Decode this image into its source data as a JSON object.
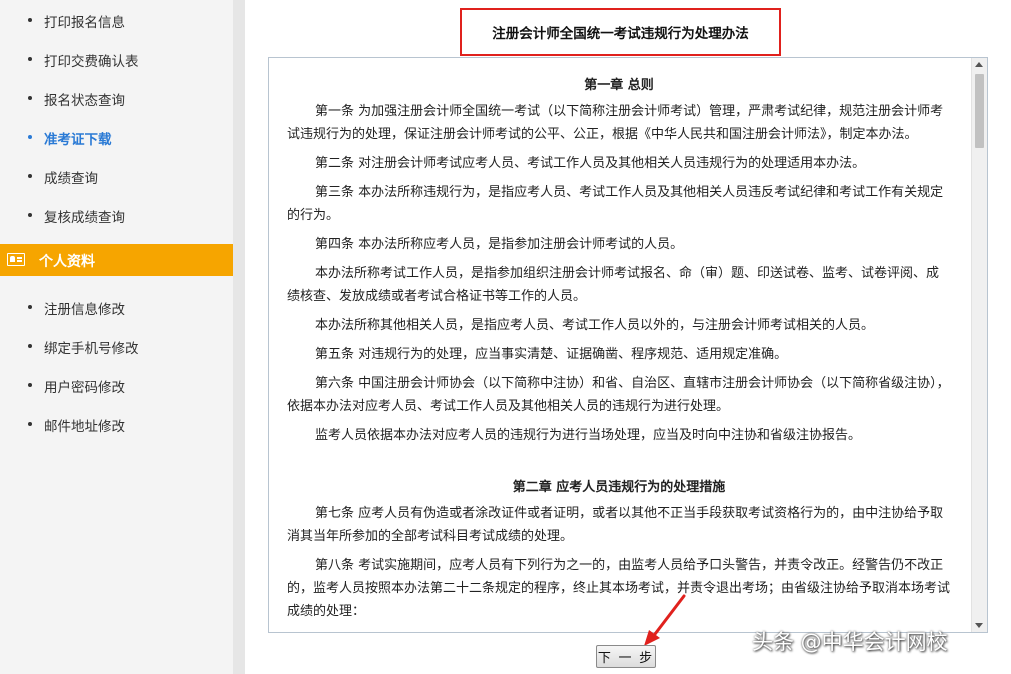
{
  "sidebar": {
    "items_top": [
      {
        "label": "打印报名信息"
      },
      {
        "label": "打印交费确认表"
      },
      {
        "label": "报名状态查询"
      },
      {
        "label": "准考证下载"
      },
      {
        "label": "成绩查询"
      },
      {
        "label": "复核成绩查询"
      }
    ],
    "section_label": "个人资料",
    "section_icon": "id-card-icon",
    "items_bottom": [
      {
        "label": "注册信息修改"
      },
      {
        "label": "绑定手机号修改"
      },
      {
        "label": "用户密码修改"
      },
      {
        "label": "邮件地址修改"
      }
    ],
    "active_item": "准考证下载",
    "accent_color": "#f6a500",
    "active_color": "#2a7ad5"
  },
  "document": {
    "title": "注册会计师全国统一考试违规行为处理办法",
    "chapter1": "第一章 总则",
    "paragraphs1": [
      "第一条 为加强注册会计师全国统一考试（以下简称注册会计师考试）管理，严肃考试纪律，规范注册会计师考试违规行为的处理，保证注册会计师考试的公平、公正，根据《中华人民共和国注册会计师法》，制定本办法。",
      "第二条 对注册会计师考试应考人员、考试工作人员及其他相关人员违规行为的处理适用本办法。",
      "第三条 本办法所称违规行为，是指应考人员、考试工作人员及其他相关人员违反考试纪律和考试工作有关规定的行为。",
      "第四条 本办法所称应考人员，是指参加注册会计师考试的人员。",
      "本办法所称考试工作人员，是指参加组织注册会计师考试报名、命（审）题、印送试卷、监考、试卷评阅、成绩核查、发放成绩或者考试合格证书等工作的人员。",
      "本办法所称其他相关人员，是指应考人员、考试工作人员以外的，与注册会计师考试相关的人员。",
      "第五条 对违规行为的处理，应当事实清楚、证据确凿、程序规范、适用规定准确。",
      "第六条 中国注册会计师协会（以下简称中注协）和省、自治区、直辖市注册会计师协会（以下简称省级注协），依据本办法对应考人员、考试工作人员及其他相关人员的违规行为进行处理。",
      "监考人员依据本办法对应考人员的违规行为进行当场处理，应当及时向中注协和省级注协报告。"
    ],
    "chapter2": "第二章 应考人员违规行为的处理措施",
    "paragraphs2": [
      "第七条 应考人员有伪造或者涂改证件或者证明，或者以其他不正当手段获取考试资格行为的，由中注协给予取消其当年所参加的全部考试科目考试成绩的处理。",
      "第八条 考试实施期间，应考人员有下列行为之一的，由监考人员给予口头警告，并责令改正。经警告仍不改正的，监考人员按照本办法第二十二条规定的程序，终止其本场考试，并责令退出考场；由省级注协给予取消本场考试成绩的处理："
    ]
  },
  "next_button_label": "下 一 步",
  "watermark_text": "头条 @中华会计网校"
}
